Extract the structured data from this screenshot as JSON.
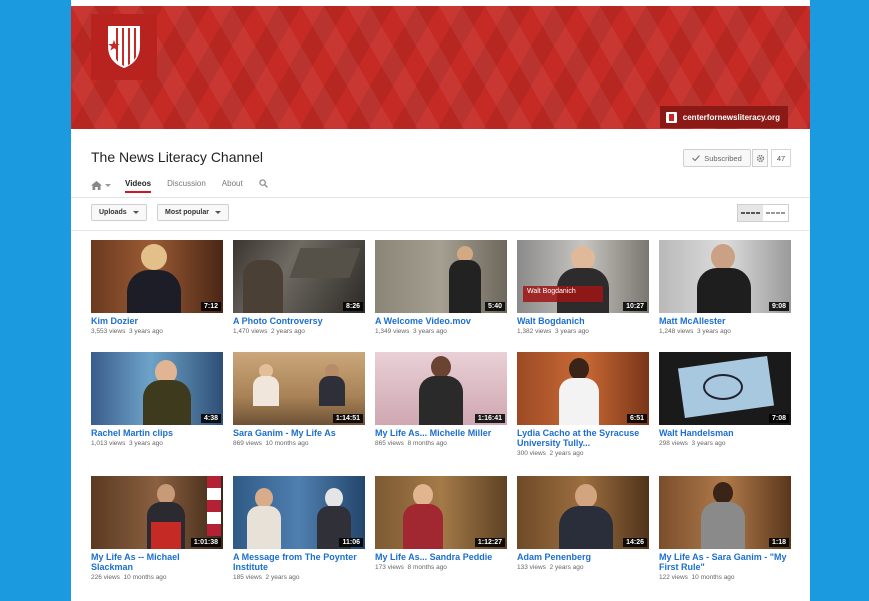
{
  "channel": {
    "title": "The News Literacy Channel",
    "website": "centerfornewsliteracy.org",
    "subscribe_label": "Subscribed",
    "subscriber_count": "47"
  },
  "tabs": [
    {
      "label": "Videos",
      "active": true
    },
    {
      "label": "Discussion",
      "active": false
    },
    {
      "label": "About",
      "active": false
    }
  ],
  "filters": {
    "uploads_label": "Uploads",
    "sort_label": "Most popular"
  },
  "colors": {
    "accent": "#cc181e",
    "link": "#1b6fd0",
    "banner": "#c52a25",
    "background": "#1c9ae0"
  },
  "videos": [
    {
      "title": "Kim Dozier",
      "views": "3,553 views",
      "age": "3 years ago",
      "duration": "7:12",
      "overlay": ""
    },
    {
      "title": "A Photo Controversy",
      "views": "1,470 views",
      "age": "2 years ago",
      "duration": "8:26",
      "overlay": ""
    },
    {
      "title": "A Welcome Video.mov",
      "views": "1,349 views",
      "age": "3 years ago",
      "duration": "5:40",
      "overlay": ""
    },
    {
      "title": "Walt Bogdanich",
      "views": "1,382 views",
      "age": "3 years ago",
      "duration": "10:27",
      "overlay": "Walt Bogdanich"
    },
    {
      "title": "Matt McAllester",
      "views": "1,248 views",
      "age": "3 years ago",
      "duration": "9:08",
      "overlay": ""
    },
    {
      "title": "Rachel Martin clips",
      "views": "1,013 views",
      "age": "3 years ago",
      "duration": "4:38",
      "overlay": ""
    },
    {
      "title": "Sara Ganim - My Life As",
      "views": "869 views",
      "age": "10 months ago",
      "duration": "1:14:51",
      "overlay": ""
    },
    {
      "title": "My Life As... Michelle Miller",
      "views": "865 views",
      "age": "8 months ago",
      "duration": "1:16:41",
      "overlay": ""
    },
    {
      "title": "Lydia Cacho at the Syracuse University Tully...",
      "views": "300 views",
      "age": "2 years ago",
      "duration": "6:51",
      "overlay": ""
    },
    {
      "title": "Walt Handelsman",
      "views": "298 views",
      "age": "3 years ago",
      "duration": "7:08",
      "overlay": ""
    },
    {
      "title": "My Life As -- Michael Slackman",
      "views": "226 views",
      "age": "10 months ago",
      "duration": "1:01:38",
      "overlay": ""
    },
    {
      "title": "A Message from The Poynter Institute",
      "views": "185 views",
      "age": "2 years ago",
      "duration": "11:06",
      "overlay": ""
    },
    {
      "title": "My Life As... Sandra Peddie",
      "views": "173 views",
      "age": "8 months ago",
      "duration": "1:12:27",
      "overlay": ""
    },
    {
      "title": "Adam Penenberg",
      "views": "133 views",
      "age": "2 years ago",
      "duration": "14:26",
      "overlay": ""
    },
    {
      "title": "My Life As - Sara Ganim - \"My First Rule\"",
      "views": "122 views",
      "age": "10 months ago",
      "duration": "1:18",
      "overlay": ""
    }
  ]
}
